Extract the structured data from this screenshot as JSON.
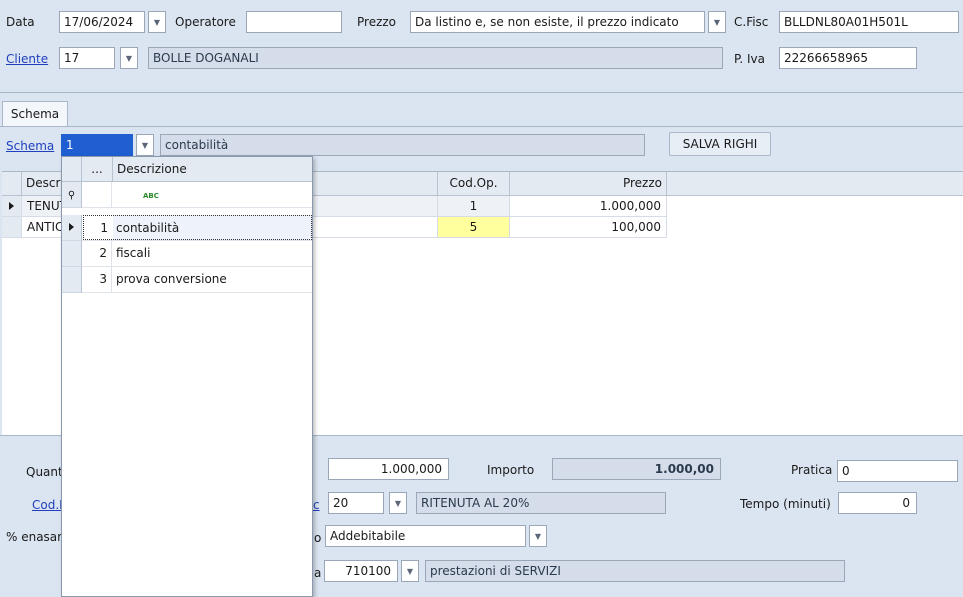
{
  "header": {
    "data_label": "Data",
    "data_value": "17/06/2024",
    "operatore_label": "Operatore",
    "operatore_value": "",
    "prezzo_label": "Prezzo",
    "prezzo_value": "Da listino e, se non esiste, il prezzo indicato",
    "cfisc_label": "C.Fisc",
    "cfisc_value": "BLLDNL80A01H501L",
    "cliente_label": "Cliente",
    "cliente_code": "17",
    "cliente_name": "BOLLE DOGANALI",
    "piva_label": "P. Iva",
    "piva_value": "22266658965"
  },
  "tabs": [
    "Schema"
  ],
  "schema": {
    "label": "Schema",
    "code": "1",
    "desc": "contabilità",
    "save_button": "SALVA RIGHI"
  },
  "grid": {
    "columns": [
      "Descr",
      "Cod.Op.",
      "Prezzo"
    ],
    "rows": [
      {
        "descr": "TENUT",
        "codop": "1",
        "prezzo": "1.000,000"
      },
      {
        "descr": "ANTIC",
        "codop": "5",
        "prezzo": "100,000"
      }
    ]
  },
  "dropdown": {
    "col_dots": "...",
    "col_desc": "Descrizione",
    "filter_icon": "ABC",
    "rows": [
      {
        "id": "1",
        "desc": "contabilità"
      },
      {
        "id": "2",
        "desc": "fiscali"
      },
      {
        "id": "3",
        "desc": "prova conversione"
      }
    ]
  },
  "bottom": {
    "quant_label": "Quant",
    "prezzo_value": "1.000,000",
    "importo_label": "Importo",
    "importo_value": "1.000,00",
    "pratica_label": "Pratica",
    "pratica_value": "0",
    "codi_label": "Cod.I",
    "rit_label_tail": "c",
    "rit_code": "20",
    "rit_desc": "RITENUTA AL 20%",
    "tempo_label": "Tempo (minuti)",
    "tempo_value": "0",
    "enasar_label": "% enasar",
    "tipo_label_tail": "o",
    "tipo_value": "Addebitabile",
    "cat_label_tail": "a",
    "cat_code": "710100",
    "cat_desc": "prestazioni di SERVIZI"
  },
  "colors": {
    "background": "#dbe5f1",
    "link": "#1f3fbf",
    "selected_field": "#1f5fd1",
    "highlight_cell": "#ffff9e"
  }
}
